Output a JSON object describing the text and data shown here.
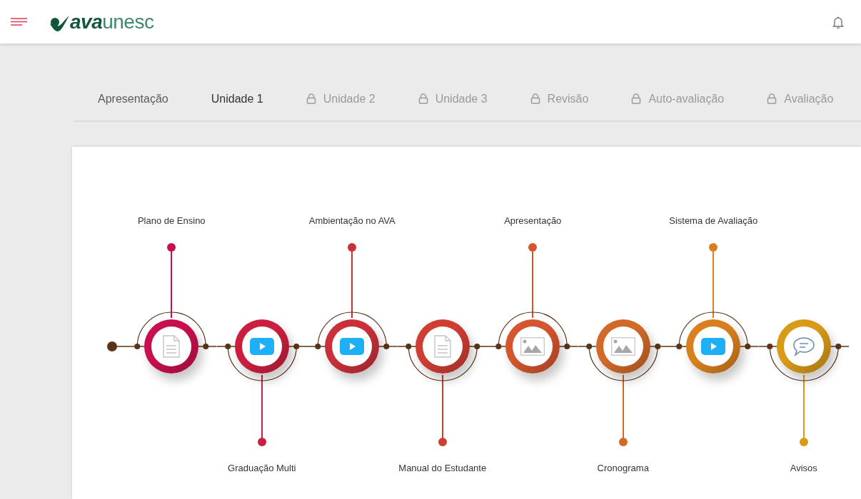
{
  "header": {
    "logo": {
      "bold": "ava",
      "light": "unesc"
    }
  },
  "tabs": [
    {
      "label": "Apresentação",
      "selected": false,
      "locked": false
    },
    {
      "label": "Unidade 1",
      "selected": true,
      "locked": false
    },
    {
      "label": "Unidade 2",
      "selected": false,
      "locked": true
    },
    {
      "label": "Unidade 3",
      "selected": false,
      "locked": true
    },
    {
      "label": "Revisão",
      "selected": false,
      "locked": true
    },
    {
      "label": "Auto-avaliação",
      "selected": false,
      "locked": true
    },
    {
      "label": "Avaliação",
      "selected": false,
      "locked": true
    }
  ],
  "timeline": [
    {
      "label": "Plano de Ensino",
      "kind": "document",
      "color": "#c8104f"
    },
    {
      "label": "Graduação Multi",
      "kind": "video",
      "color": "#cc1f3f"
    },
    {
      "label": "Ambientação no AVA",
      "kind": "video",
      "color": "#c9303a"
    },
    {
      "label": "Manual do Estudante",
      "kind": "document",
      "color": "#cf3d33"
    },
    {
      "label": "Apresentação",
      "kind": "image",
      "color": "#d4552e"
    },
    {
      "label": "Cronograma",
      "kind": "image",
      "color": "#d16a28"
    },
    {
      "label": "Sistema de Avaliação",
      "kind": "video",
      "color": "#d9801e"
    },
    {
      "label": "Avisos",
      "kind": "chat",
      "color": "#d99a18"
    }
  ]
}
